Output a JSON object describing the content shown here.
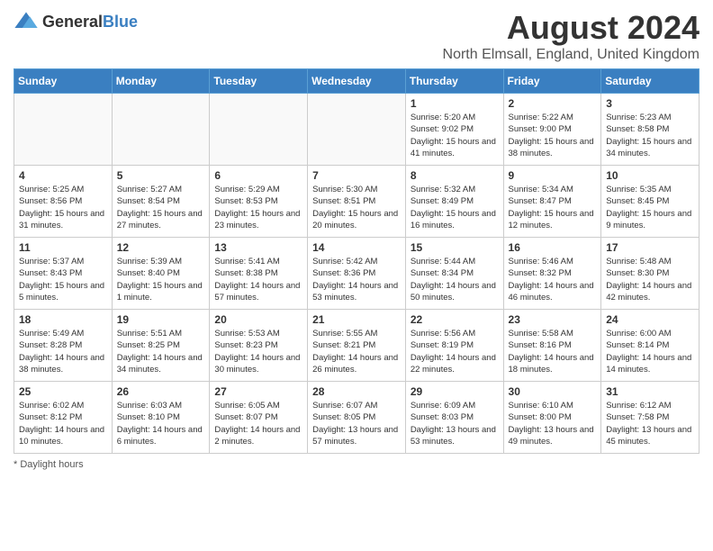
{
  "logo": {
    "general": "General",
    "blue": "Blue"
  },
  "title": "August 2024",
  "location": "North Elmsall, England, United Kingdom",
  "days_of_week": [
    "Sunday",
    "Monday",
    "Tuesday",
    "Wednesday",
    "Thursday",
    "Friday",
    "Saturday"
  ],
  "footer": "Daylight hours",
  "weeks": [
    [
      {
        "day": "",
        "info": ""
      },
      {
        "day": "",
        "info": ""
      },
      {
        "day": "",
        "info": ""
      },
      {
        "day": "",
        "info": ""
      },
      {
        "day": "1",
        "info": "Sunrise: 5:20 AM\nSunset: 9:02 PM\nDaylight: 15 hours and 41 minutes."
      },
      {
        "day": "2",
        "info": "Sunrise: 5:22 AM\nSunset: 9:00 PM\nDaylight: 15 hours and 38 minutes."
      },
      {
        "day": "3",
        "info": "Sunrise: 5:23 AM\nSunset: 8:58 PM\nDaylight: 15 hours and 34 minutes."
      }
    ],
    [
      {
        "day": "4",
        "info": "Sunrise: 5:25 AM\nSunset: 8:56 PM\nDaylight: 15 hours and 31 minutes."
      },
      {
        "day": "5",
        "info": "Sunrise: 5:27 AM\nSunset: 8:54 PM\nDaylight: 15 hours and 27 minutes."
      },
      {
        "day": "6",
        "info": "Sunrise: 5:29 AM\nSunset: 8:53 PM\nDaylight: 15 hours and 23 minutes."
      },
      {
        "day": "7",
        "info": "Sunrise: 5:30 AM\nSunset: 8:51 PM\nDaylight: 15 hours and 20 minutes."
      },
      {
        "day": "8",
        "info": "Sunrise: 5:32 AM\nSunset: 8:49 PM\nDaylight: 15 hours and 16 minutes."
      },
      {
        "day": "9",
        "info": "Sunrise: 5:34 AM\nSunset: 8:47 PM\nDaylight: 15 hours and 12 minutes."
      },
      {
        "day": "10",
        "info": "Sunrise: 5:35 AM\nSunset: 8:45 PM\nDaylight: 15 hours and 9 minutes."
      }
    ],
    [
      {
        "day": "11",
        "info": "Sunrise: 5:37 AM\nSunset: 8:43 PM\nDaylight: 15 hours and 5 minutes."
      },
      {
        "day": "12",
        "info": "Sunrise: 5:39 AM\nSunset: 8:40 PM\nDaylight: 15 hours and 1 minute."
      },
      {
        "day": "13",
        "info": "Sunrise: 5:41 AM\nSunset: 8:38 PM\nDaylight: 14 hours and 57 minutes."
      },
      {
        "day": "14",
        "info": "Sunrise: 5:42 AM\nSunset: 8:36 PM\nDaylight: 14 hours and 53 minutes."
      },
      {
        "day": "15",
        "info": "Sunrise: 5:44 AM\nSunset: 8:34 PM\nDaylight: 14 hours and 50 minutes."
      },
      {
        "day": "16",
        "info": "Sunrise: 5:46 AM\nSunset: 8:32 PM\nDaylight: 14 hours and 46 minutes."
      },
      {
        "day": "17",
        "info": "Sunrise: 5:48 AM\nSunset: 8:30 PM\nDaylight: 14 hours and 42 minutes."
      }
    ],
    [
      {
        "day": "18",
        "info": "Sunrise: 5:49 AM\nSunset: 8:28 PM\nDaylight: 14 hours and 38 minutes."
      },
      {
        "day": "19",
        "info": "Sunrise: 5:51 AM\nSunset: 8:25 PM\nDaylight: 14 hours and 34 minutes."
      },
      {
        "day": "20",
        "info": "Sunrise: 5:53 AM\nSunset: 8:23 PM\nDaylight: 14 hours and 30 minutes."
      },
      {
        "day": "21",
        "info": "Sunrise: 5:55 AM\nSunset: 8:21 PM\nDaylight: 14 hours and 26 minutes."
      },
      {
        "day": "22",
        "info": "Sunrise: 5:56 AM\nSunset: 8:19 PM\nDaylight: 14 hours and 22 minutes."
      },
      {
        "day": "23",
        "info": "Sunrise: 5:58 AM\nSunset: 8:16 PM\nDaylight: 14 hours and 18 minutes."
      },
      {
        "day": "24",
        "info": "Sunrise: 6:00 AM\nSunset: 8:14 PM\nDaylight: 14 hours and 14 minutes."
      }
    ],
    [
      {
        "day": "25",
        "info": "Sunrise: 6:02 AM\nSunset: 8:12 PM\nDaylight: 14 hours and 10 minutes."
      },
      {
        "day": "26",
        "info": "Sunrise: 6:03 AM\nSunset: 8:10 PM\nDaylight: 14 hours and 6 minutes."
      },
      {
        "day": "27",
        "info": "Sunrise: 6:05 AM\nSunset: 8:07 PM\nDaylight: 14 hours and 2 minutes."
      },
      {
        "day": "28",
        "info": "Sunrise: 6:07 AM\nSunset: 8:05 PM\nDaylight: 13 hours and 57 minutes."
      },
      {
        "day": "29",
        "info": "Sunrise: 6:09 AM\nSunset: 8:03 PM\nDaylight: 13 hours and 53 minutes."
      },
      {
        "day": "30",
        "info": "Sunrise: 6:10 AM\nSunset: 8:00 PM\nDaylight: 13 hours and 49 minutes."
      },
      {
        "day": "31",
        "info": "Sunrise: 6:12 AM\nSunset: 7:58 PM\nDaylight: 13 hours and 45 minutes."
      }
    ]
  ]
}
